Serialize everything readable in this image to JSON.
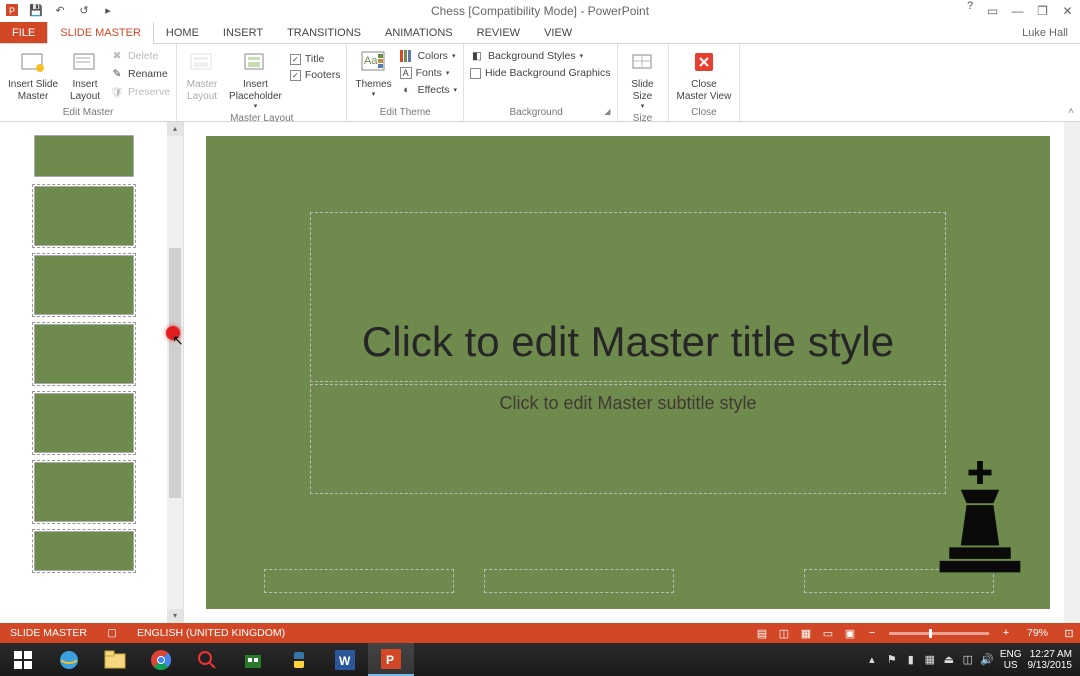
{
  "title": "Chess [Compatibility Mode] - PowerPoint",
  "user": "Luke Hall",
  "tabs": {
    "file": "FILE",
    "slidemaster": "SLIDE MASTER",
    "home": "HOME",
    "insert": "INSERT",
    "transitions": "TRANSITIONS",
    "animations": "ANIMATIONS",
    "review": "REVIEW",
    "view": "VIEW"
  },
  "ribbon": {
    "editmaster": {
      "label": "Edit Master",
      "insert_slide_master": "Insert Slide\nMaster",
      "insert_layout": "Insert\nLayout",
      "delete": "Delete",
      "rename": "Rename",
      "preserve": "Preserve"
    },
    "masterlayout": {
      "label": "Master Layout",
      "master_layout": "Master\nLayout",
      "insert_placeholder": "Insert\nPlaceholder",
      "title": "Title",
      "footers": "Footers"
    },
    "edittheme": {
      "label": "Edit Theme",
      "themes": "Themes",
      "colors": "Colors",
      "fonts": "Fonts",
      "effects": "Effects"
    },
    "background": {
      "label": "Background",
      "styles": "Background Styles",
      "hide": "Hide Background Graphics"
    },
    "size": {
      "label": "Size",
      "slide_size": "Slide\nSize"
    },
    "close": {
      "label": "Close",
      "close_master": "Close\nMaster View"
    }
  },
  "slide": {
    "title": "Click to edit Master title style",
    "subtitle": "Click to edit Master subtitle style"
  },
  "status": {
    "mode": "SLIDE MASTER",
    "language": "ENGLISH (UNITED KINGDOM)",
    "zoom": "79%"
  },
  "tray": {
    "lang1": "ENG",
    "lang2": "US",
    "time": "12:27 AM",
    "date": "9/13/2015"
  }
}
